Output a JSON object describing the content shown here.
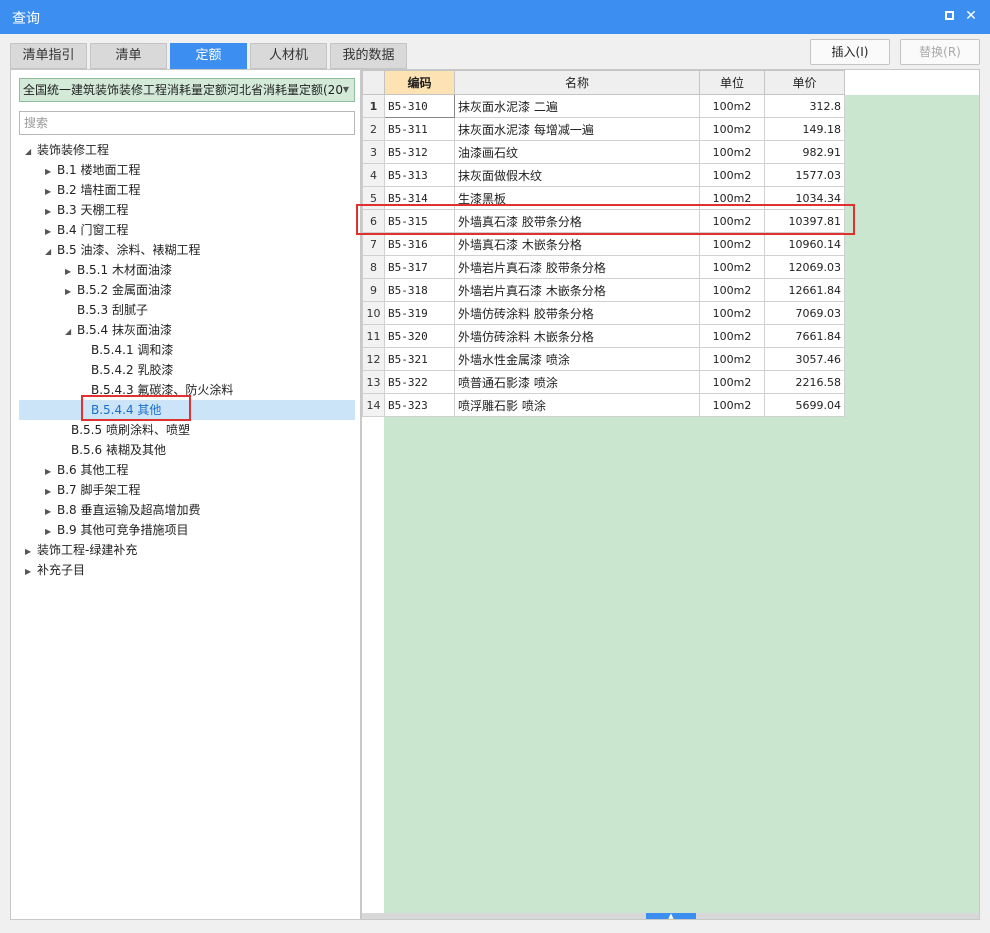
{
  "window": {
    "title": "查询"
  },
  "tabs": [
    {
      "label": "清单指引",
      "active": false
    },
    {
      "label": "清单",
      "active": false
    },
    {
      "label": "定额",
      "active": true
    },
    {
      "label": "人材机",
      "active": false
    },
    {
      "label": "我的数据",
      "active": false
    }
  ],
  "toolbar": {
    "insert_label": "插入(I)",
    "replace_label": "替换(R)"
  },
  "library_select": {
    "value": "全国统一建筑装饰装修工程消耗量定额河北省消耗量定额(20"
  },
  "search": {
    "placeholder": "搜索"
  },
  "tree": [
    {
      "label": "装饰装修工程",
      "state": "expanded"
    },
    {
      "label": "B.1 楼地面工程",
      "state": "collapsed"
    },
    {
      "label": "B.2 墙柱面工程",
      "state": "collapsed"
    },
    {
      "label": "B.3 天棚工程",
      "state": "collapsed"
    },
    {
      "label": "B.4 门窗工程",
      "state": "collapsed"
    },
    {
      "label": "B.5 油漆、涂料、裱糊工程",
      "state": "expanded"
    },
    {
      "label": "B.5.1 木材面油漆",
      "state": "collapsed"
    },
    {
      "label": "B.5.2 金属面油漆",
      "state": "collapsed"
    },
    {
      "label": "B.5.3 刮腻子",
      "state": "leaf"
    },
    {
      "label": "B.5.4 抹灰面油漆",
      "state": "expanded"
    },
    {
      "label": "B.5.4.1 调和漆",
      "state": "leaf"
    },
    {
      "label": "B.5.4.2 乳胶漆",
      "state": "leaf"
    },
    {
      "label": "B.5.4.3 氟碳漆、防火涂料",
      "state": "leaf"
    },
    {
      "label": "B.5.4.4 其他",
      "state": "leaf",
      "selected": true
    },
    {
      "label": "B.5.5 喷刷涂料、喷塑",
      "state": "leaf"
    },
    {
      "label": "B.5.6 裱糊及其他",
      "state": "leaf"
    },
    {
      "label": "B.6 其他工程",
      "state": "collapsed"
    },
    {
      "label": "B.7 脚手架工程",
      "state": "collapsed"
    },
    {
      "label": "B.8 垂直运输及超高增加费",
      "state": "collapsed"
    },
    {
      "label": "B.9 其他可竞争措施项目",
      "state": "collapsed"
    },
    {
      "label": "装饰工程-绿建补充",
      "state": "collapsed"
    },
    {
      "label": "补充子目",
      "state": "collapsed"
    }
  ],
  "table": {
    "headers": {
      "code": "编码",
      "name": "名称",
      "unit": "单位",
      "price": "单价"
    },
    "rows": [
      {
        "num": "1",
        "code": "B5-310",
        "name": "抹灰面水泥漆 二遍",
        "unit": "100m2",
        "price": "312.8"
      },
      {
        "num": "2",
        "code": "B5-311",
        "name": "抹灰面水泥漆 每增减一遍",
        "unit": "100m2",
        "price": "149.18"
      },
      {
        "num": "3",
        "code": "B5-312",
        "name": "油漆画石纹",
        "unit": "100m2",
        "price": "982.91"
      },
      {
        "num": "4",
        "code": "B5-313",
        "name": "抹灰面做假木纹",
        "unit": "100m2",
        "price": "1577.03"
      },
      {
        "num": "5",
        "code": "B5-314",
        "name": "生漆黑板",
        "unit": "100m2",
        "price": "1034.34"
      },
      {
        "num": "6",
        "code": "B5-315",
        "name": "外墙真石漆 胶带条分格",
        "unit": "100m2",
        "price": "10397.81"
      },
      {
        "num": "7",
        "code": "B5-316",
        "name": "外墙真石漆 木嵌条分格",
        "unit": "100m2",
        "price": "10960.14"
      },
      {
        "num": "8",
        "code": "B5-317",
        "name": "外墙岩片真石漆 胶带条分格",
        "unit": "100m2",
        "price": "12069.03"
      },
      {
        "num": "9",
        "code": "B5-318",
        "name": "外墙岩片真石漆 木嵌条分格",
        "unit": "100m2",
        "price": "12661.84"
      },
      {
        "num": "10",
        "code": "B5-319",
        "name": "外墙仿砖涂料 胶带条分格",
        "unit": "100m2",
        "price": "7069.03"
      },
      {
        "num": "11",
        "code": "B5-320",
        "name": "外墙仿砖涂料 木嵌条分格",
        "unit": "100m2",
        "price": "7661.84"
      },
      {
        "num": "12",
        "code": "B5-321",
        "name": "外墙水性金属漆 喷涂",
        "unit": "100m2",
        "price": "3057.46"
      },
      {
        "num": "13",
        "code": "B5-322",
        "name": "喷普通石影漆 喷涂",
        "unit": "100m2",
        "price": "2216.58"
      },
      {
        "num": "14",
        "code": "B5-323",
        "name": "喷浮雕石影 喷涂",
        "unit": "100m2",
        "price": "5699.04"
      }
    ]
  },
  "colors": {
    "accent": "#3c8ff0",
    "highlight_box": "#e0302f",
    "grid_background": "#cbe6cf",
    "code_header": "#fde3b4"
  }
}
